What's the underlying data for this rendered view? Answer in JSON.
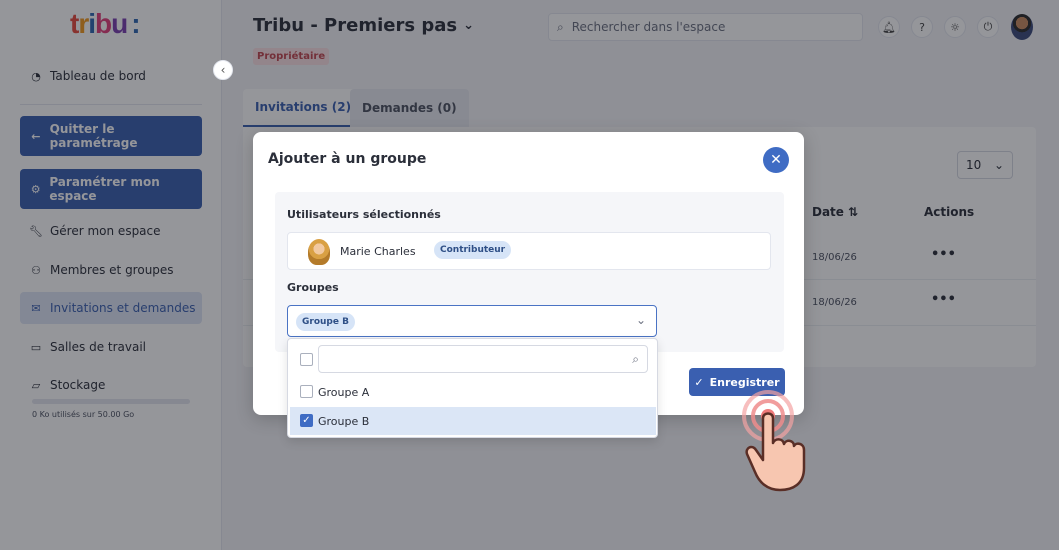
{
  "brand": {
    "logo_text": "tribu:"
  },
  "sidebar": {
    "dashboard_label": "Tableau de bord",
    "quit_label": "Quitter le paramétrage",
    "configure_label": "Paramétrer mon espace",
    "items": [
      {
        "label": "Gérer mon espace",
        "icon": "wrench-icon"
      },
      {
        "label": "Membres et groupes",
        "icon": "users-icon"
      },
      {
        "label": "Invitations et demandes",
        "icon": "mail-icon",
        "active": true
      },
      {
        "label": "Salles de travail",
        "icon": "folder-icon"
      },
      {
        "label": "Stockage",
        "icon": "folder-open-icon"
      }
    ],
    "storage_text": "0 Ko utilisés sur 50.00 Go",
    "storage_used_fraction": 0
  },
  "header": {
    "title": "Tribu - Premiers pas",
    "owner_badge": "Propriétaire",
    "search_placeholder": "Rechercher dans l'espace"
  },
  "tabs": [
    {
      "label": "Invitations (2)",
      "active": true
    },
    {
      "label": "Demandes (0)",
      "active": false
    }
  ],
  "table": {
    "per_page": "10",
    "columns": [
      "Date ⇅",
      "Actions"
    ],
    "rows": [
      {
        "date": "18/06/26",
        "actions": "•••"
      },
      {
        "date": "18/06/26",
        "actions": "•••"
      }
    ]
  },
  "modal": {
    "title": "Ajouter à un groupe",
    "selected_users_label": "Utilisateurs sélectionnés",
    "user": {
      "name": "Marie Charles",
      "role": "Contributeur"
    },
    "groups_label": "Groupes",
    "selected_group_chip": "Groupe B",
    "options": [
      {
        "label": "Groupe A",
        "checked": false
      },
      {
        "label": "Groupe B",
        "checked": true
      }
    ],
    "save_label": "Enregistrer"
  },
  "colors": {
    "primary": "#3a5fb0",
    "owner_badge_bg": "#fbe1e3",
    "owner_badge_fg": "#c2454f",
    "chip_bg": "#d6e4f7"
  }
}
